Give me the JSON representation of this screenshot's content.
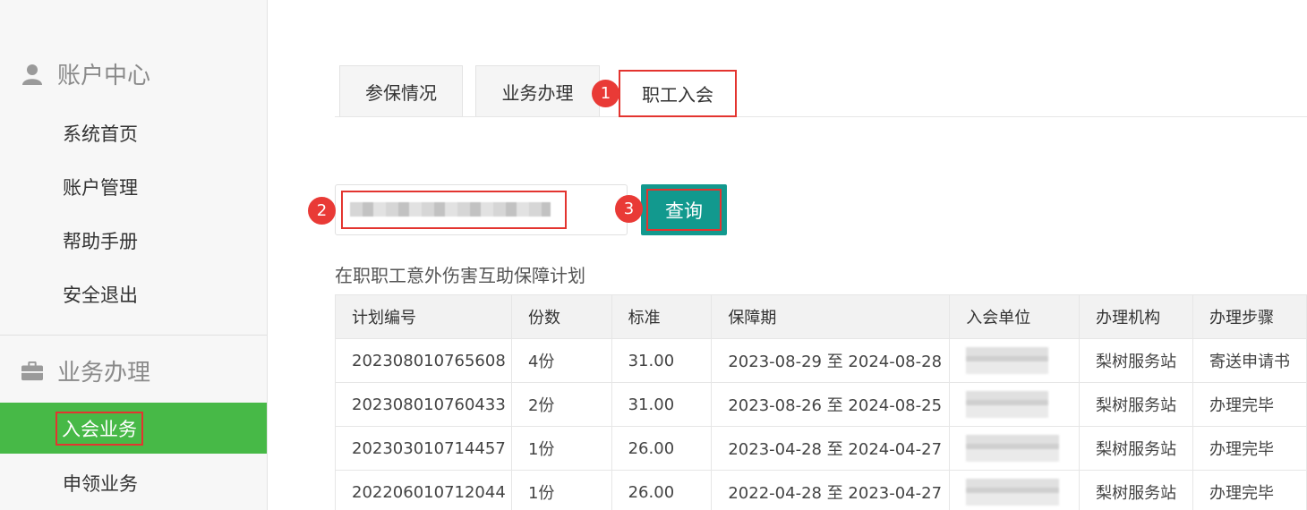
{
  "sidebar": {
    "account_section": {
      "title": "账户中心",
      "icon": "user-icon"
    },
    "account_items": [
      "系统首页",
      "账户管理",
      "帮助手册",
      "安全退出"
    ],
    "business_section": {
      "title": "业务办理",
      "icon": "briefcase-icon"
    },
    "business_items": [
      "入会业务",
      "申领业务"
    ],
    "active_color": "#47b947"
  },
  "tabs": [
    "参保情况",
    "业务办理",
    "职工入会"
  ],
  "badges": [
    "1",
    "2",
    "3"
  ],
  "search": {
    "button_label": "查询",
    "button_color": "#12998e"
  },
  "plan_title": "在职职工意外伤害互助保障计划",
  "table": {
    "headers": [
      "计划编号",
      "份数",
      "标准",
      "保障期",
      "入会单位",
      "办理机构",
      "办理步骤"
    ],
    "rows": [
      [
        "202308010765608",
        "4份",
        "31.00",
        "2023-08-29 至 2024-08-28",
        "",
        "梨树服务站",
        "寄送申请书"
      ],
      [
        "202308010760433",
        "2份",
        "31.00",
        "2023-08-26 至 2024-08-25",
        "",
        "梨树服务站",
        "办理完毕"
      ],
      [
        "202303010714457",
        "1份",
        "26.00",
        "2023-04-28 至 2024-04-27",
        "",
        "梨树服务站",
        "办理完毕"
      ],
      [
        "202206010712044",
        "1份",
        "26.00",
        "2022-04-28 至 2023-04-27",
        "",
        "梨树服务站",
        "办理完毕"
      ]
    ]
  }
}
